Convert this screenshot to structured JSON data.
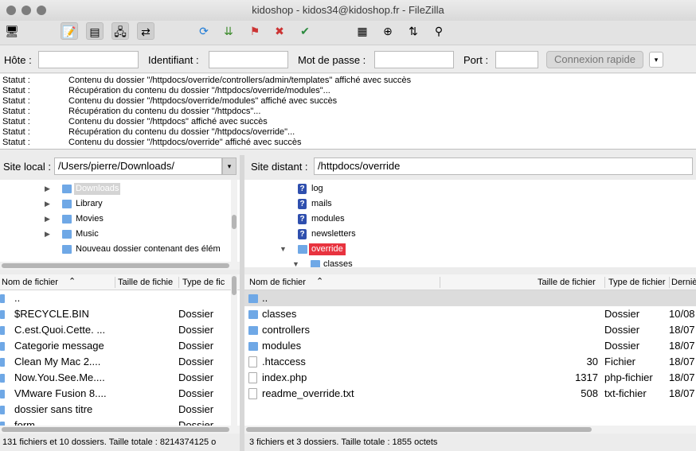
{
  "window": {
    "title": "kidoshop - kidos34@kidoshop.fr - FileZilla"
  },
  "toolbar": {
    "icons": [
      "site-manager-icon",
      "log-toggle-icon",
      "tree-toggle-icon",
      "queue-toggle-icon",
      "transfer-icon",
      "refresh-icon",
      "process-queue-icon",
      "cancel-icon",
      "disconnect-icon",
      "reconnect-icon",
      "filter-icon",
      "compare-icon",
      "sync-browse-icon",
      "search-icon"
    ]
  },
  "quickconnect": {
    "host_label": "Hôte :",
    "user_label": "Identifiant :",
    "pass_label": "Mot de passe :",
    "port_label": "Port :",
    "host_value": "",
    "user_value": "",
    "pass_value": "",
    "port_value": "",
    "button": "Connexion rapide",
    "dropdown": "▾"
  },
  "log": [
    {
      "k": "Statut :",
      "v": "Contenu du dossier \"/httpdocs/override/controllers/admin/templates\" affiché avec succès"
    },
    {
      "k": "Statut :",
      "v": "Récupération du contenu du dossier \"/httpdocs/override/modules\"..."
    },
    {
      "k": "Statut :",
      "v": "Contenu du dossier \"/httpdocs/override/modules\" affiché avec succès"
    },
    {
      "k": "Statut :",
      "v": "Récupération du contenu du dossier \"/httpdocs\"..."
    },
    {
      "k": "Statut :",
      "v": "Contenu du dossier \"/httpdocs\" affiché avec succès"
    },
    {
      "k": "Statut :",
      "v": "Récupération du contenu du dossier \"/httpdocs/override\"..."
    },
    {
      "k": "Statut :",
      "v": "Contenu du dossier \"/httpdocs/override\" affiché avec succès"
    }
  ],
  "local": {
    "site_label": "Site local :",
    "path": "/Users/pierre/Downloads/",
    "tree": [
      {
        "label": "Downloads",
        "selected": true
      },
      {
        "label": "Library"
      },
      {
        "label": "Movies"
      },
      {
        "label": "Music"
      },
      {
        "label": "Nouveau dossier contenant des élém"
      }
    ],
    "headers": {
      "name": "Nom de fichier",
      "sort": "⌃",
      "size": "Taille de fichie",
      "type": "Type de fic"
    },
    "rows": [
      {
        "name": "..",
        "type": ""
      },
      {
        "name": "$RECYCLE.BIN",
        "type": "Dossier"
      },
      {
        "name": "C.est.Quoi.Cette. ...",
        "type": "Dossier"
      },
      {
        "name": "Categorie message",
        "type": "Dossier"
      },
      {
        "name": "Clean My Mac 2....",
        "type": "Dossier"
      },
      {
        "name": "Now.You.See.Me....",
        "type": "Dossier"
      },
      {
        "name": "VMware Fusion 8....",
        "type": "Dossier"
      },
      {
        "name": "dossier sans titre",
        "type": "Dossier"
      },
      {
        "name": "form",
        "type": "Dossier"
      }
    ],
    "status": "131 fichiers et 10 dossiers. Taille totale : 8214374125 o"
  },
  "remote": {
    "site_label": "Site distant :",
    "path": "/httpdocs/override",
    "tree": [
      {
        "label": "log",
        "icon": "?"
      },
      {
        "label": "mails",
        "icon": "?"
      },
      {
        "label": "modules",
        "icon": "?"
      },
      {
        "label": "newsletters",
        "icon": "?"
      },
      {
        "label": "override",
        "selected": true
      },
      {
        "label": "classes"
      }
    ],
    "headers": {
      "name": "Nom de fichier",
      "sort": "⌃",
      "size": "Taille de fichier",
      "type": "Type de fichier",
      "modified": "Derniè"
    },
    "rows": [
      {
        "name": "..",
        "size": "",
        "type": "",
        "modified": "",
        "folder": true
      },
      {
        "name": "classes",
        "size": "",
        "type": "Dossier",
        "modified": "10/08",
        "folder": true
      },
      {
        "name": "controllers",
        "size": "",
        "type": "Dossier",
        "modified": "18/07",
        "folder": true
      },
      {
        "name": "modules",
        "size": "",
        "type": "Dossier",
        "modified": "18/07",
        "folder": true
      },
      {
        "name": ".htaccess",
        "size": "30",
        "type": "Fichier",
        "modified": "18/07",
        "folder": false
      },
      {
        "name": "index.php",
        "size": "1317",
        "type": "php-fichier",
        "modified": "18/07",
        "folder": false
      },
      {
        "name": "readme_override.txt",
        "size": "508",
        "type": "txt-fichier",
        "modified": "18/07",
        "folder": false
      }
    ],
    "status": "3 fichiers et 3 dossiers. Taille totale : 1855 octets"
  },
  "colors": {
    "selection": "#e8333f",
    "folder": "#6fa8e6",
    "unknown": "#2f4fae"
  }
}
